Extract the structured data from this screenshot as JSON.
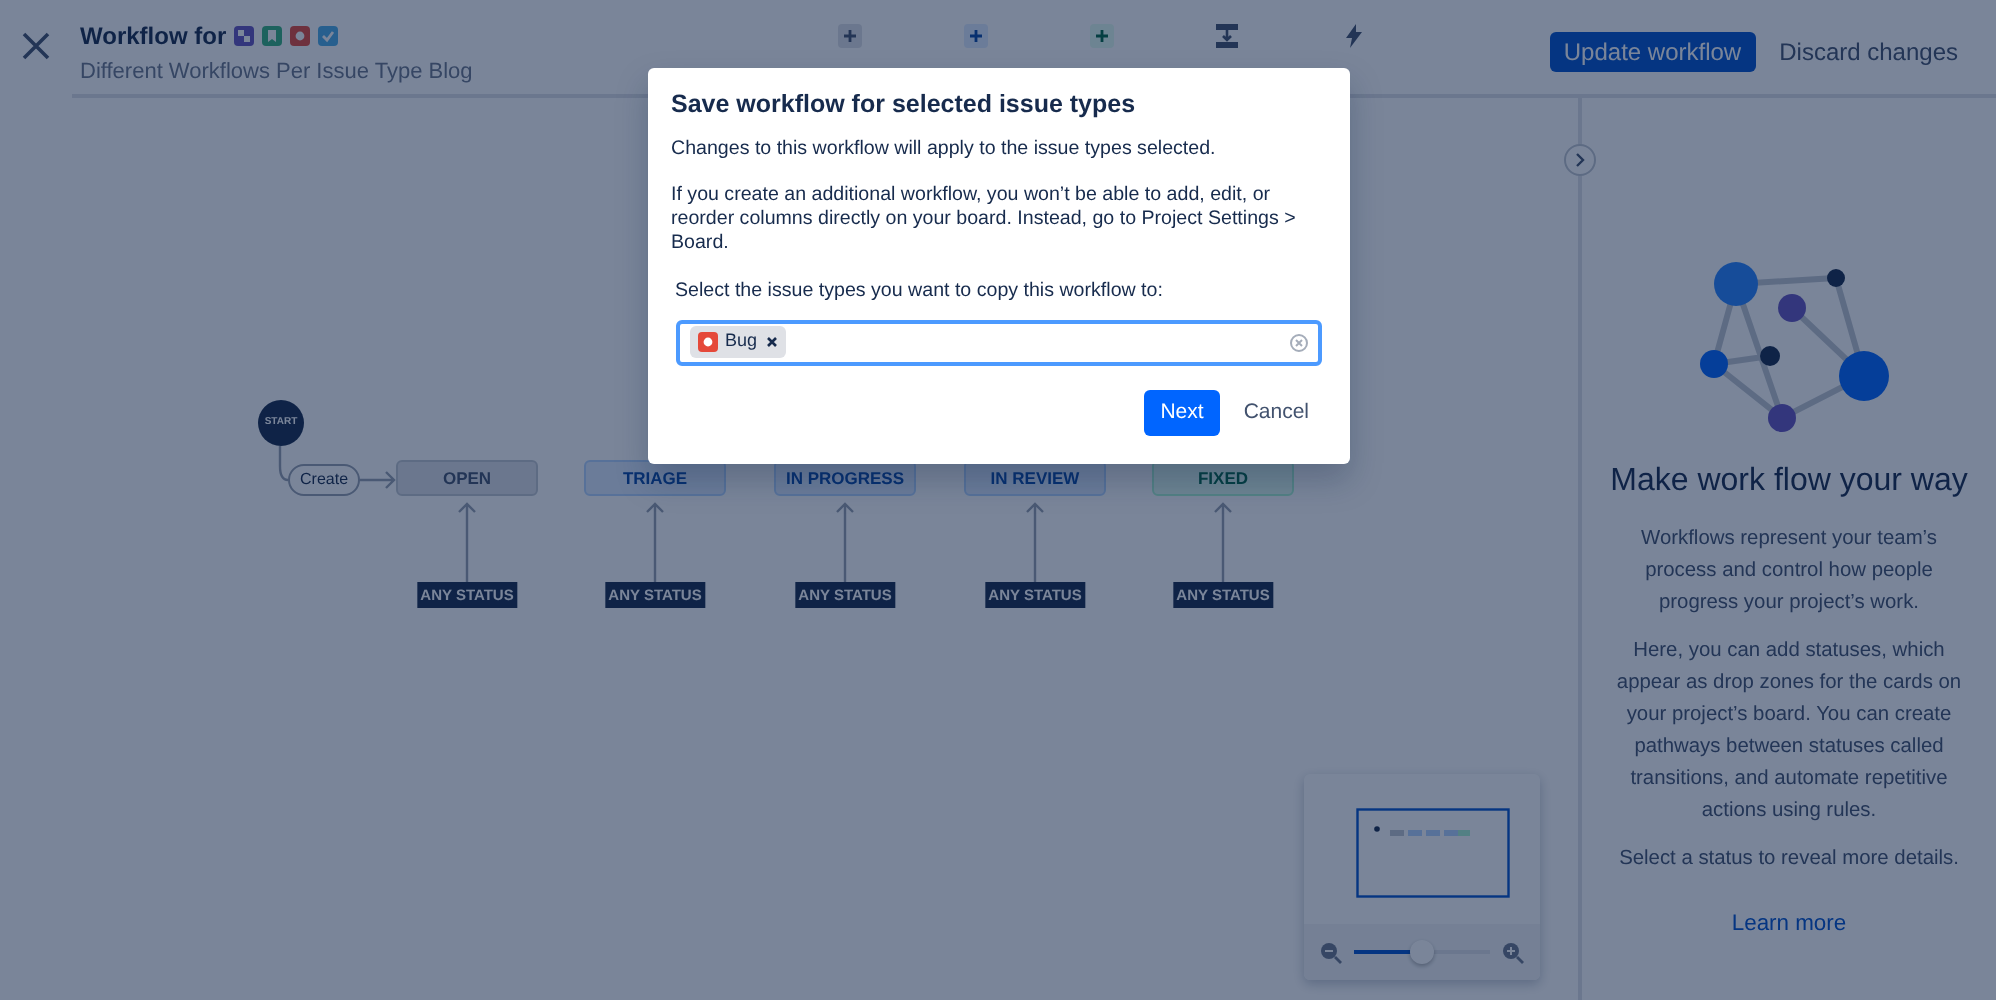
{
  "header": {
    "title": "Workflow for",
    "issue_types": [
      {
        "kind": "subtask"
      },
      {
        "kind": "story"
      },
      {
        "kind": "bug"
      },
      {
        "kind": "task"
      }
    ],
    "subtitle": "Different Workflows Per Issue Type Blog"
  },
  "toolbar": [
    {
      "kind": "todo"
    },
    {
      "kind": "inprogress"
    },
    {
      "kind": "done"
    },
    {
      "kind": "transition"
    },
    {
      "kind": "rule"
    }
  ],
  "actions": {
    "primary": "Update workflow",
    "secondary": "Discard changes"
  },
  "diagram": {
    "start": "START",
    "create": "Create",
    "statuses": [
      {
        "name": "OPEN",
        "kind": "todo",
        "source": "ANY STATUS"
      },
      {
        "name": "TRIAGE",
        "kind": "inprogress",
        "source": "ANY STATUS"
      },
      {
        "name": "IN PROGRESS",
        "kind": "inprogress",
        "source": "ANY STATUS"
      },
      {
        "name": "IN REVIEW",
        "kind": "inprogress",
        "source": "ANY STATUS"
      },
      {
        "name": "FIXED",
        "kind": "done",
        "source": "ANY STATUS"
      }
    ]
  },
  "minimap": {
    "level": 0.5
  },
  "panel": {
    "heading": "Make work flow your way",
    "paragraphs": [
      "Workflows represent your team’s process and control how people progress your project’s work.",
      "Here, you can add statuses, which appear as drop zones for the cards on your project’s board. You can create pathways between statuses called transitions, and automate repetitive actions using rules.",
      "Select a status to reveal more details."
    ],
    "link": "Learn more"
  },
  "modal": {
    "title": "Save workflow for selected issue types",
    "paragraphs": [
      "Changes to this workflow will apply to the issue types selected.",
      "If you create an additional workflow, you won’t be able to add, edit, or reorder columns directly on your board. Instead, go to Project Settings > Board."
    ],
    "field_label": "Select the issue types you want to copy this workflow to:",
    "chips": [
      {
        "label": "Bug",
        "kind": "bug",
        "color": "#e5493a"
      }
    ],
    "buttons": [
      {
        "label": "Next",
        "kind": "primary"
      },
      {
        "label": "Cancel",
        "kind": "subtle"
      }
    ]
  }
}
